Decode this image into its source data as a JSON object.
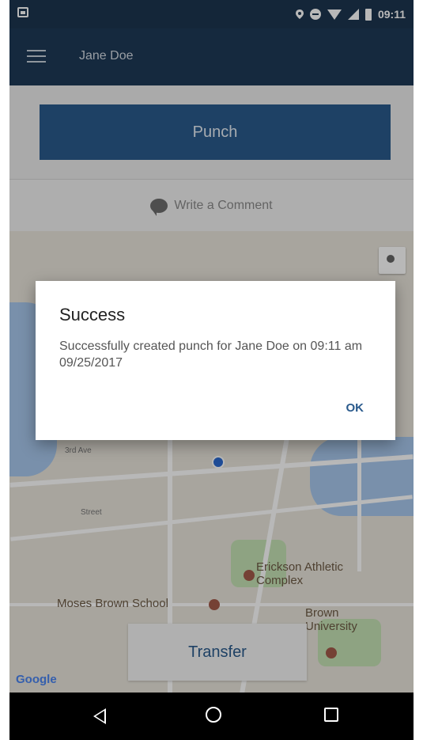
{
  "status_bar": {
    "time": "09:11",
    "icons": [
      "image-icon",
      "location-pin-icon",
      "do-not-disturb-icon",
      "wifi-icon",
      "signal-icon",
      "battery-icon"
    ]
  },
  "app_bar": {
    "title": "Jane Doe",
    "menu_icon": "menu-icon"
  },
  "punch": {
    "button_label": "Punch",
    "comment_label": "Write a Comment"
  },
  "map": {
    "poi": [
      {
        "label": "Erickson Athletic Complex"
      },
      {
        "label": "Moses Brown School"
      },
      {
        "label": "Brown University"
      }
    ],
    "attribution": "Google"
  },
  "transfer": {
    "button_label": "Transfer"
  },
  "dialog": {
    "title": "Success",
    "message": "Successfully created punch for Jane Doe on 09:11 am 09/25/2017",
    "ok_label": "OK"
  },
  "nav_bar": {
    "icons": [
      "back-icon",
      "home-icon",
      "recents-icon"
    ]
  }
}
